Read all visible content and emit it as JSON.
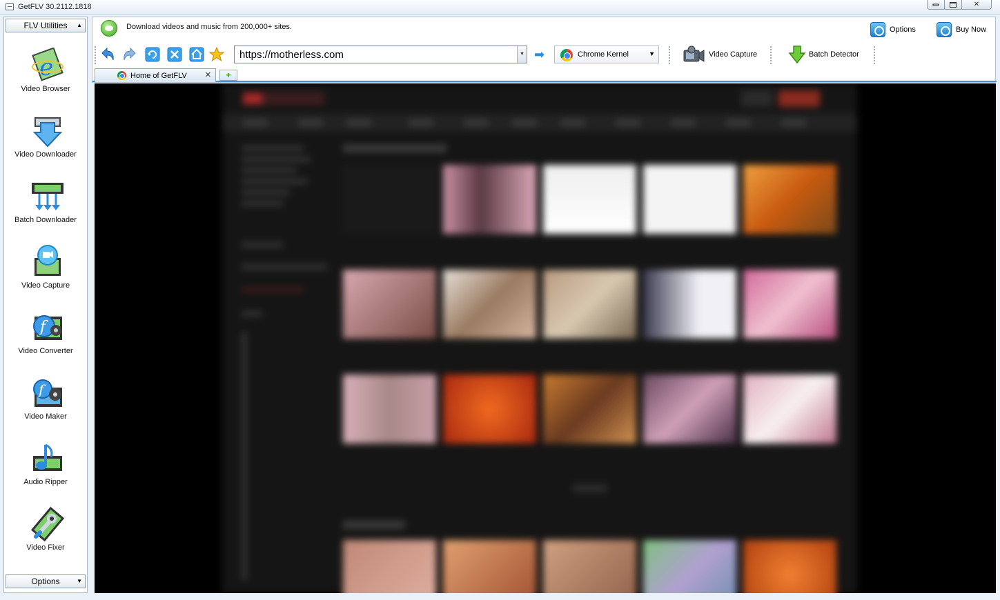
{
  "window": {
    "title": "GetFLV 30.2112.1818"
  },
  "sidebar": {
    "header": "FLV Utilities",
    "footer": "Options",
    "tools": [
      {
        "label": "Video Browser",
        "icon": "video-browser-icon"
      },
      {
        "label": "Video Downloader",
        "icon": "video-downloader-icon"
      },
      {
        "label": "Batch Downloader",
        "icon": "batch-downloader-icon"
      },
      {
        "label": "Video Capture",
        "icon": "video-capture-icon"
      },
      {
        "label": "Video Converter",
        "icon": "video-converter-icon"
      },
      {
        "label": "Video Maker",
        "icon": "video-maker-icon"
      },
      {
        "label": "Audio Ripper",
        "icon": "audio-ripper-icon"
      },
      {
        "label": "Video Fixer",
        "icon": "video-fixer-icon"
      }
    ]
  },
  "header": {
    "promo_text": "Download videos and music from 200,000+ sites.",
    "options_label": "Options",
    "buy_label": "Buy Now"
  },
  "toolbar": {
    "url": "https://motherless.com",
    "kernel": "Chrome Kernel",
    "video_capture_label": "Video Capture",
    "batch_detector_label": "Batch Detector"
  },
  "tabs": [
    {
      "label": "Home of GetFLV"
    }
  ],
  "colors": {
    "tab_underline": "#4b90d4",
    "viewport_background": "#000000",
    "accent": "#2a8ee0"
  }
}
